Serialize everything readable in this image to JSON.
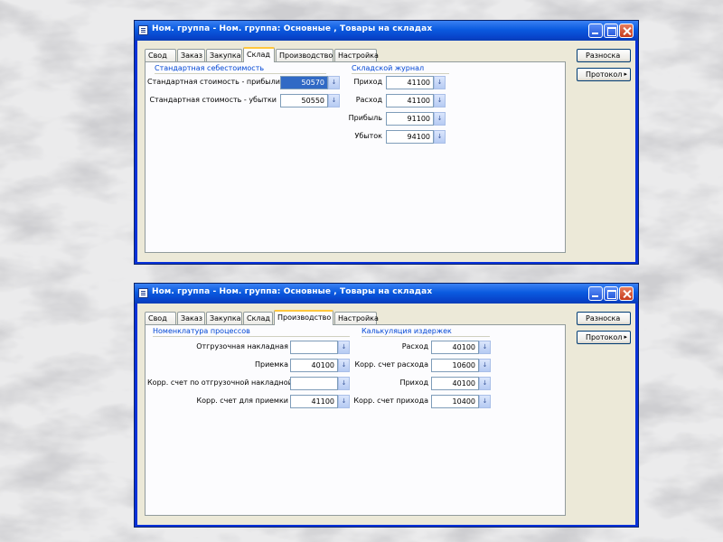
{
  "window1": {
    "title": "Ном. группа - Ном. группа: Основные , Товары на складах",
    "tabs": [
      "Свод",
      "Заказ",
      "Закупка",
      "Склад",
      "Производство",
      "Настройка"
    ],
    "active_tab": "Склад",
    "group_left": "Стандартная себестоимость",
    "group_right": "Складской журнал",
    "left_fields": [
      {
        "label": "Стандартная стоимость - прибыли",
        "value": "50570"
      },
      {
        "label": "Стандартная стоимость - убытки",
        "value": "50550"
      }
    ],
    "right_fields": [
      {
        "label": "Приход",
        "value": "41100"
      },
      {
        "label": "Расход",
        "value": "41100"
      },
      {
        "label": "Прибыль",
        "value": "91100"
      },
      {
        "label": "Убыток",
        "value": "94100"
      }
    ],
    "buttons": [
      {
        "label": "Разноска",
        "arrow": ""
      },
      {
        "label": "Протокол",
        "arrow": "▸"
      }
    ]
  },
  "window2": {
    "title": "Ном. группа - Ном. группа: Основные , Товары на складах",
    "tabs": [
      "Свод",
      "Заказ",
      "Закупка",
      "Склад",
      "Производство",
      "Настройка"
    ],
    "active_tab": "Производство",
    "group_left": "Номенклатура процессов",
    "group_right": "Калькуляция издержек",
    "left_fields": [
      {
        "label": "Отгрузочная накладная",
        "value": ""
      },
      {
        "label": "Приемка",
        "value": "40100"
      },
      {
        "label": "Корр. счет по отгрузочной накладной",
        "value": ""
      },
      {
        "label": "Корр. счет для приемки",
        "value": "41100"
      }
    ],
    "right_fields": [
      {
        "label": "Расход",
        "value": "40100"
      },
      {
        "label": "Корр. счет расхода",
        "value": "10600"
      },
      {
        "label": "Приход",
        "value": "40100"
      },
      {
        "label": "Корр. счет прихода",
        "value": "10400"
      }
    ],
    "buttons": [
      {
        "label": "Разноска",
        "arrow": ""
      },
      {
        "label": "Протокол",
        "arrow": "▸"
      }
    ]
  },
  "icons": {
    "spin": "↓"
  },
  "colors": {
    "titlebar": "#0a5adf",
    "active_tab_accent": "#ffc73c",
    "group_title": "#0046d5",
    "selection": "#316ac5"
  }
}
